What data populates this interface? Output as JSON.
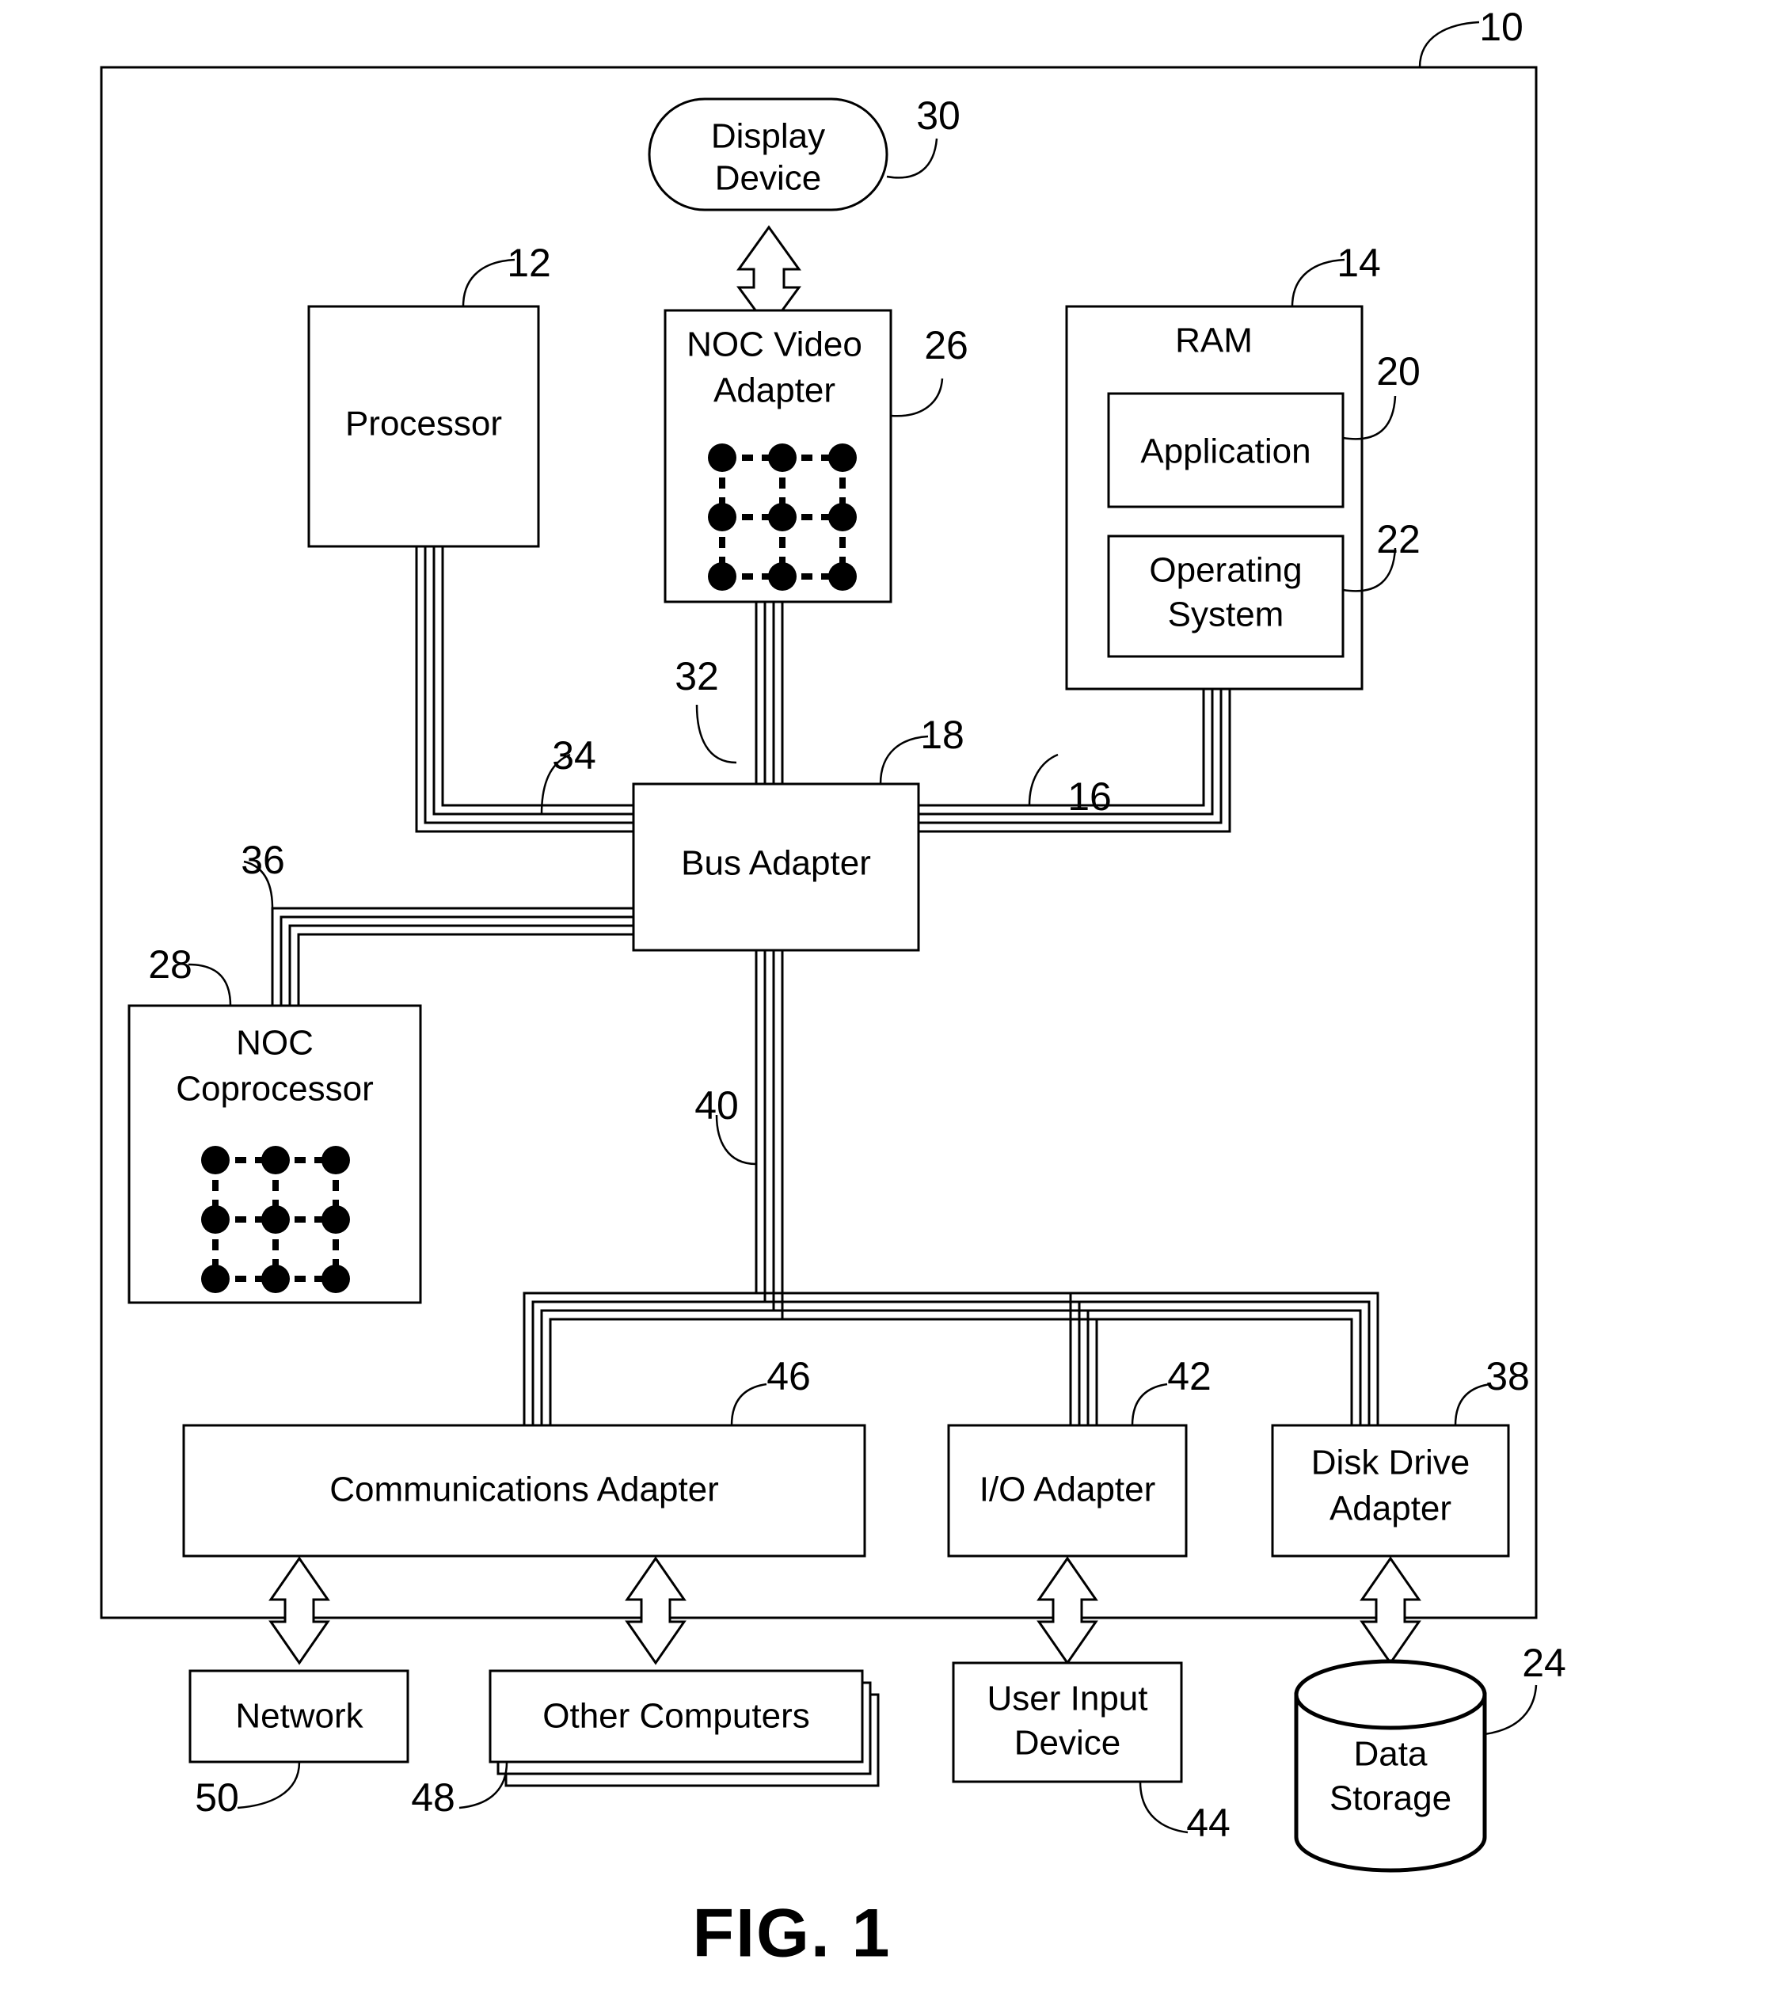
{
  "figure": {
    "caption": "FIG. 1",
    "system_ref": "10"
  },
  "nodes": {
    "display_device": {
      "label_line1": "Display",
      "label_line2": "Device",
      "ref": "30"
    },
    "processor": {
      "label": "Processor",
      "ref": "12"
    },
    "noc_video_adapter": {
      "label_line1": "NOC Video",
      "label_line2": "Adapter",
      "ref": "26"
    },
    "ram": {
      "label": "RAM",
      "ref": "14"
    },
    "application": {
      "label": "Application",
      "ref": "20"
    },
    "operating_system": {
      "label_line1": "Operating",
      "label_line2": "System",
      "ref": "22"
    },
    "bus_adapter": {
      "label": "Bus Adapter",
      "ref": "18"
    },
    "noc_coprocessor": {
      "label_line1": "NOC",
      "label_line2": "Coprocessor",
      "ref": "28"
    },
    "communications_adapter": {
      "label": "Communications Adapter",
      "ref": "46"
    },
    "io_adapter": {
      "label": "I/O Adapter",
      "ref": "42"
    },
    "disk_drive_adapter": {
      "label_line1": "Disk Drive",
      "label_line2": "Adapter",
      "ref": "38"
    },
    "network": {
      "label": "Network",
      "ref": "50"
    },
    "other_computers": {
      "label": "Other Computers",
      "ref": "48"
    },
    "user_input_device": {
      "label_line1": "User Input",
      "label_line2": "Device",
      "ref": "44"
    },
    "data_storage": {
      "label_line1": "Data",
      "label_line2": "Storage",
      "ref": "24"
    }
  },
  "buses": {
    "video_bus": {
      "ref": "32"
    },
    "front_side_bus": {
      "ref": "34"
    },
    "coprocessor_bus": {
      "ref": "36"
    },
    "memory_bus": {
      "ref": "16"
    },
    "expansion_bus": {
      "ref": "40"
    }
  },
  "colors": {
    "stroke": "#000000",
    "fill": "#ffffff"
  }
}
